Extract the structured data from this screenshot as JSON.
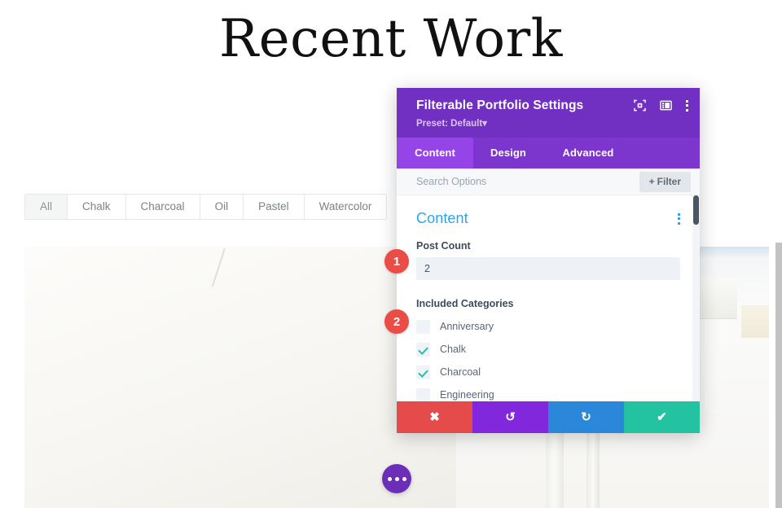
{
  "page": {
    "title": "Recent Work"
  },
  "portfolio_filters": {
    "items": [
      {
        "label": "All",
        "active": true
      },
      {
        "label": "Chalk",
        "active": false
      },
      {
        "label": "Charcoal",
        "active": false
      },
      {
        "label": "Oil",
        "active": false
      },
      {
        "label": "Pastel",
        "active": false
      },
      {
        "label": "Watercolor",
        "active": false
      }
    ]
  },
  "fab": {
    "icon": "ellipsis-horizontal-icon",
    "color": "#6c2eb9"
  },
  "modal": {
    "title": "Filterable Portfolio Settings",
    "preset": "Preset: Default",
    "preset_caret": "▾",
    "header_icons": [
      {
        "name": "focus-target-icon"
      },
      {
        "name": "layout-panel-icon"
      },
      {
        "name": "overflow-menu-icon"
      }
    ],
    "tabs": [
      {
        "label": "Content",
        "active": true
      },
      {
        "label": "Design",
        "active": false
      },
      {
        "label": "Advanced",
        "active": false
      }
    ],
    "search": {
      "placeholder": "Search Options",
      "value": ""
    },
    "filter_button": {
      "plus": "+",
      "label": "Filter"
    },
    "section": {
      "title": "Content",
      "menu_icon": "overflow-menu-icon"
    },
    "post_count": {
      "label": "Post Count",
      "value": "2"
    },
    "included_categories": {
      "label": "Included Categories",
      "items": [
        {
          "label": "Anniversary",
          "checked": false
        },
        {
          "label": "Chalk",
          "checked": true
        },
        {
          "label": "Charcoal",
          "checked": true
        },
        {
          "label": "Engineering",
          "checked": false
        }
      ]
    },
    "footer_actions": [
      {
        "name": "discard-button",
        "glyph": "✖",
        "color": "#e64b4b"
      },
      {
        "name": "undo-button",
        "glyph": "↺",
        "color": "#8128dd"
      },
      {
        "name": "redo-button",
        "glyph": "↻",
        "color": "#2b87da"
      },
      {
        "name": "save-button",
        "glyph": "✔",
        "color": "#23c3a2"
      }
    ]
  },
  "callouts": [
    {
      "number": "1"
    },
    {
      "number": "2"
    }
  ],
  "colors": {
    "modal_header_purple": "#7230c3",
    "tab_active_purple": "#9444e7",
    "section_title_blue": "#2ea3f2",
    "checkmark_teal": "#21c3a4",
    "badge_red": "#ea4c46"
  }
}
